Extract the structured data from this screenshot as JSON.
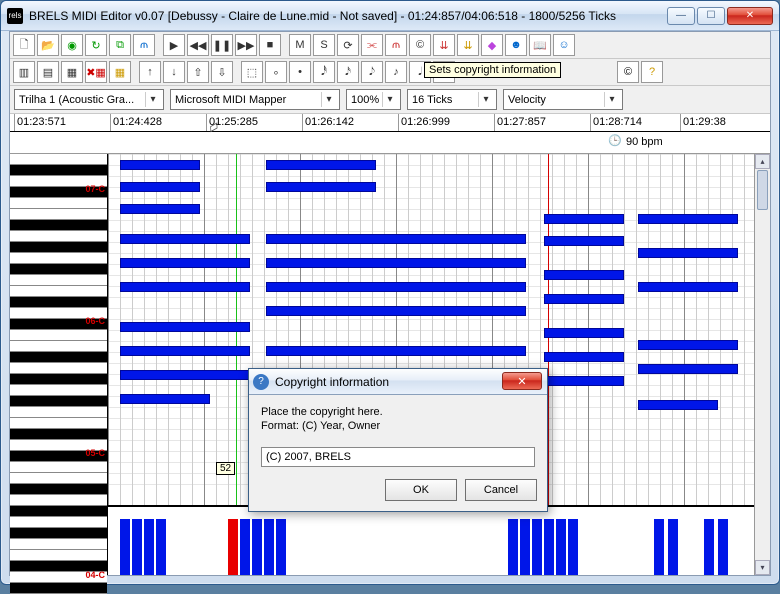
{
  "window": {
    "app_icon_text": "rels",
    "title": "BRELS MIDI Editor v0.07 [Debussy - Claire de Lune.mid - Not saved] - 01:24:857/04:06:518 - 1800/5256 Ticks"
  },
  "tooltip": {
    "text": "Sets copyright information"
  },
  "selectors": {
    "track": "Trilha 1 (Acoustic Gra...",
    "device": "Microsoft MIDI Mapper",
    "zoom": "100%",
    "grid": "16 Ticks",
    "lane": "Velocity"
  },
  "ruler": {
    "ticks": [
      {
        "pos": 4,
        "label": "01:23:571"
      },
      {
        "pos": 100,
        "label": "01:24:428"
      },
      {
        "pos": 196,
        "label": "01:25:285"
      },
      {
        "pos": 292,
        "label": "01:26:142"
      },
      {
        "pos": 388,
        "label": "01:26:999"
      },
      {
        "pos": 484,
        "label": "01:27:857"
      },
      {
        "pos": 580,
        "label": "01:28:714"
      },
      {
        "pos": 670,
        "label": "01:29:38"
      }
    ]
  },
  "tempo": {
    "bpm_label": "90 bpm"
  },
  "piano_labels": {
    "c07": "07-C",
    "c06": "06-C",
    "c05": "05-C",
    "c04": "04-C"
  },
  "badge": {
    "value": "52"
  },
  "dialog": {
    "title": "Copyright information",
    "line1": "Place the copyright here.",
    "line2": "Format: (C) Year, Owner",
    "input_value": "(C) 2007, BRELS",
    "ok": "OK",
    "cancel": "Cancel"
  },
  "icons": {
    "new": "🗋",
    "open": "📂",
    "play": "▶",
    "rew": "◀◀",
    "pause": "❚❚",
    "ffwd": "▶▶",
    "stop": "■",
    "m": "M",
    "s": "S",
    "loop": "⟳",
    "c": "©",
    "eraser": "◧",
    "book": "📖",
    "help": "?",
    "info": "ℹ",
    "rect": "▭",
    "dot": "·",
    "note": "♪",
    "note2": "♫",
    "arrow_up": "↑",
    "arrow_down": "↓",
    "arrow_up2": "⇧",
    "arrow_down2": "⇩",
    "sel": "⬚",
    "clock": "🕒",
    "min": "—",
    "max": "☐",
    "close": "✕"
  }
}
